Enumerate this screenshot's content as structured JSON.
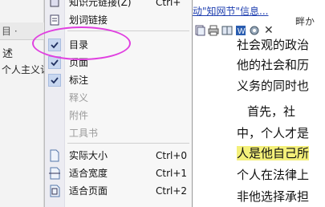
{
  "left_panel": {
    "toolbar_text": "目 ·",
    "heading": "述",
    "text_line": "个人主义认"
  },
  "document": {
    "link_text": "动\"知网节\"信息...",
    "top_right_text": "畔か",
    "lines": [
      "社会观的政治",
      "他的社会和历",
      "义务的同时也",
      "　　首先，社",
      "中，个人才是",
      "人是他自己所",
      "个人在法律上",
      "非他选择承担"
    ],
    "highlighted_line_index": 5
  },
  "menu": {
    "items": [
      {
        "label": "知识元链接(Z)",
        "shortcut": "Ctrl+",
        "icon": "link-icon",
        "state": "normal"
      },
      {
        "label": "划词链接",
        "shortcut": "",
        "icon": "link-word-icon",
        "state": "normal"
      },
      {
        "label": "目录",
        "shortcut": "",
        "icon": "check-icon",
        "state": "checked"
      },
      {
        "label": "页面",
        "shortcut": "",
        "icon": "check-icon",
        "state": "checked"
      },
      {
        "label": "标注",
        "shortcut": "",
        "icon": "check-icon",
        "state": "checked"
      },
      {
        "label": "释义",
        "shortcut": "",
        "icon": "",
        "state": "disabled"
      },
      {
        "label": "附件",
        "shortcut": "",
        "icon": "",
        "state": "disabled"
      },
      {
        "label": "工具书",
        "shortcut": "",
        "icon": "",
        "state": "disabled"
      },
      {
        "label": "实际大小",
        "shortcut": "Ctrl+0",
        "icon": "page-icon",
        "state": "normal"
      },
      {
        "label": "适合宽度",
        "shortcut": "Ctrl+1",
        "icon": "fit-width-icon",
        "state": "normal"
      },
      {
        "label": "适合页面",
        "shortcut": "Ctrl+2",
        "icon": "fit-page-icon",
        "state": "normal"
      }
    ]
  },
  "colors": {
    "highlight_ellipse": "#e040e0",
    "text_highlight": "#f4f07a",
    "check_bg": "#c8d7f0"
  }
}
